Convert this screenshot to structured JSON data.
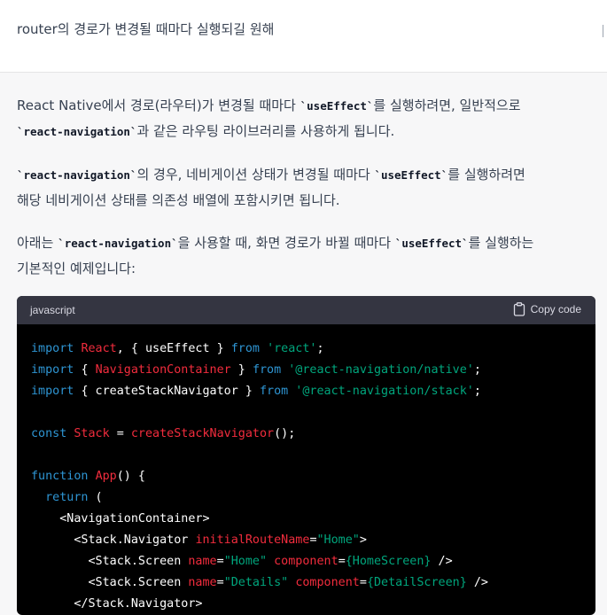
{
  "user": {
    "message": "router의 경로가 변경될 때마다 실행되길 원해"
  },
  "answer": {
    "p1": {
      "a": "React Native에서 경로(라우터)가 변경될 때마다 ",
      "code1": "`useEffect`",
      "b": "를 실행하려면, 일반적으로",
      "code2": "`react-navigation`",
      "c": "과 같은 라우팅 라이브러리를 사용하게 됩니다."
    },
    "p2": {
      "code1": "`react-navigation`",
      "a": "의 경우, 네비게이션 상태가 변경될 때마다 ",
      "code2": "`useEffect`",
      "b": "를 실행하려면",
      "c": "해당 네비게이션 상태를 의존성 배열에 포함시키면 됩니다."
    },
    "p3": {
      "a": "아래는 ",
      "code1": "`react-navigation`",
      "b": "을 사용할 때, 화면 경로가 바뀔 때마다 ",
      "code2": "`useEffect`",
      "c": "를 실행하는",
      "d": "기본적인 예제입니다:"
    }
  },
  "code": {
    "language": "javascript",
    "copy_label": "Copy code",
    "lines": [
      [
        [
          "kw",
          "import "
        ],
        [
          "id",
          "React"
        ],
        [
          "pl",
          ", { useEffect } "
        ],
        [
          "kw",
          "from "
        ],
        [
          "st",
          "'react'"
        ],
        [
          "pl",
          ";"
        ]
      ],
      [
        [
          "kw",
          "import "
        ],
        [
          "pl",
          "{ "
        ],
        [
          "id",
          "NavigationContainer"
        ],
        [
          "pl",
          " } "
        ],
        [
          "kw",
          "from "
        ],
        [
          "st",
          "'@react-navigation/native'"
        ],
        [
          "pl",
          ";"
        ]
      ],
      [
        [
          "kw",
          "import "
        ],
        [
          "pl",
          "{ createStackNavigator } "
        ],
        [
          "kw",
          "from "
        ],
        [
          "st",
          "'@react-navigation/stack'"
        ],
        [
          "pl",
          ";"
        ]
      ],
      [],
      [
        [
          "kw",
          "const "
        ],
        [
          "id",
          "Stack"
        ],
        [
          "pl",
          " = "
        ],
        [
          "id",
          "createStackNavigator"
        ],
        [
          "pl",
          "();"
        ]
      ],
      [],
      [
        [
          "kw",
          "function "
        ],
        [
          "id",
          "App"
        ],
        [
          "pl",
          "() {"
        ]
      ],
      [
        [
          "pl",
          "  "
        ],
        [
          "kw",
          "return"
        ],
        [
          "pl",
          " ("
        ]
      ],
      [
        [
          "pl",
          "    <NavigationContainer>"
        ]
      ],
      [
        [
          "pl",
          "      <Stack.Navigator "
        ],
        [
          "id",
          "initialRouteName"
        ],
        [
          "pl",
          "="
        ],
        [
          "st",
          "\"Home\""
        ],
        [
          "pl",
          ">"
        ]
      ],
      [
        [
          "pl",
          "        <Stack.Screen "
        ],
        [
          "id",
          "name"
        ],
        [
          "pl",
          "="
        ],
        [
          "st",
          "\"Home\""
        ],
        [
          "pl",
          " "
        ],
        [
          "id",
          "component"
        ],
        [
          "pl",
          "="
        ],
        [
          "st",
          "{HomeScreen}"
        ],
        [
          "pl",
          " />"
        ]
      ],
      [
        [
          "pl",
          "        <Stack.Screen "
        ],
        [
          "id",
          "name"
        ],
        [
          "pl",
          "="
        ],
        [
          "st",
          "\"Details\""
        ],
        [
          "pl",
          " "
        ],
        [
          "id",
          "component"
        ],
        [
          "pl",
          "="
        ],
        [
          "st",
          "{DetailScreen}"
        ],
        [
          "pl",
          " />"
        ]
      ],
      [
        [
          "pl",
          "      </Stack.Navigator>"
        ]
      ]
    ]
  }
}
